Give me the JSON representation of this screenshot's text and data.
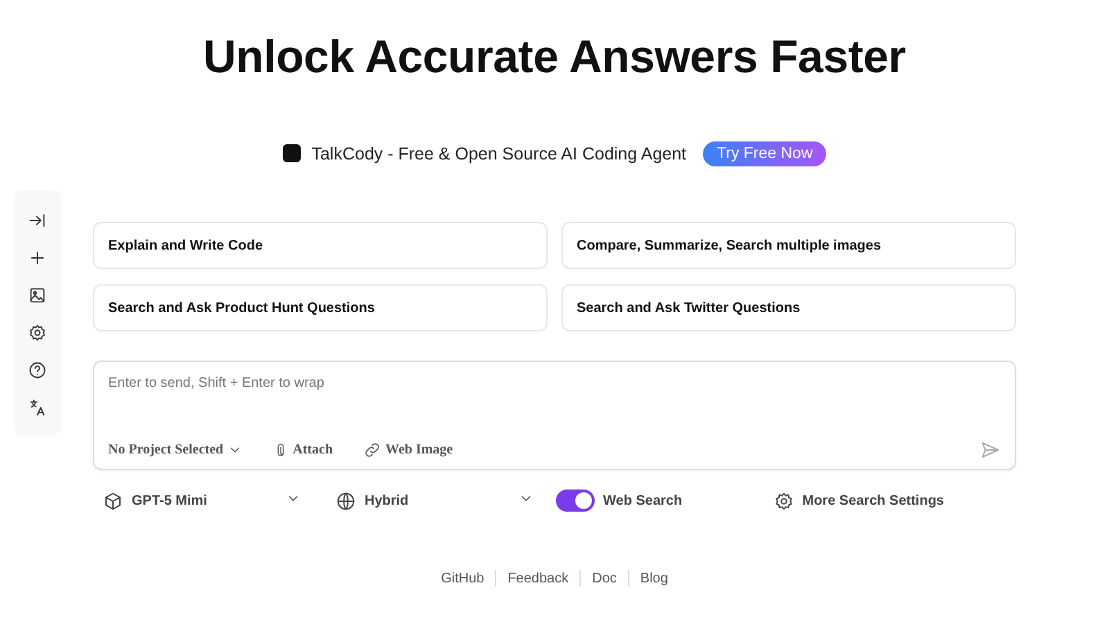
{
  "header": {
    "title": "Unlock Accurate Answers Faster",
    "tagline": "TalkCody - Free & Open Source AI Coding Agent",
    "cta": "Try Free Now"
  },
  "sidebar": {
    "items": [
      {
        "kind": "collapse"
      },
      {
        "kind": "new"
      },
      {
        "kind": "image"
      },
      {
        "kind": "settings"
      },
      {
        "kind": "help"
      },
      {
        "kind": "language"
      }
    ]
  },
  "suggestions": [
    {
      "label": "Explain and Write Code"
    },
    {
      "label": "Compare, Summarize, Search multiple images"
    },
    {
      "label": "Search and Ask Product Hunt Questions"
    },
    {
      "label": "Search and Ask Twitter Questions"
    }
  ],
  "composer": {
    "placeholder": "Enter to send, Shift + Enter to wrap",
    "project": "No Project Selected",
    "attach": "Attach",
    "web_image": "Web Image"
  },
  "options": {
    "model": "GPT-5 Mimi",
    "mode": "Hybrid",
    "web_search": {
      "label": "Web Search",
      "on": true
    },
    "more": "More Search Settings"
  },
  "footer": [
    "GitHub",
    "Feedback",
    "Doc",
    "Blog"
  ]
}
